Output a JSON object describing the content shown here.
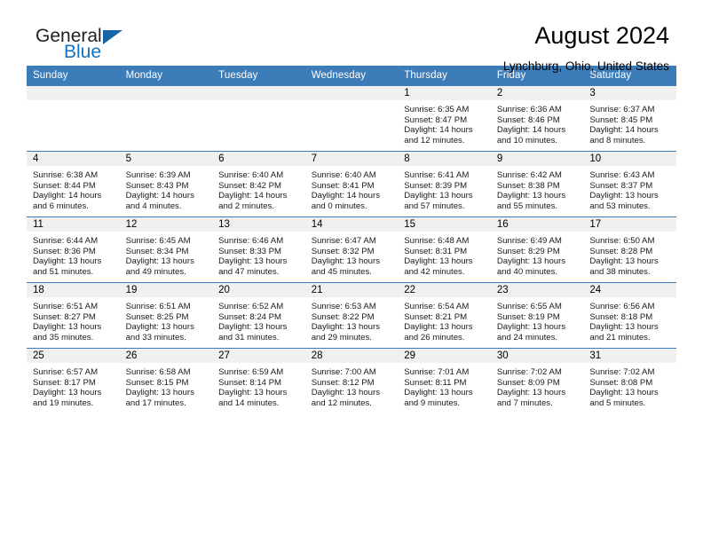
{
  "brand": {
    "word1": "General",
    "word2": "Blue",
    "triangle_color": "#1565a8",
    "word2_color": "#1272c4"
  },
  "header": {
    "title": "August 2024",
    "subtitle": "Lynchburg, Ohio, United States"
  },
  "theme": {
    "header_blue": "#3c7cb8",
    "daynum_band": "#f0f0f0",
    "row_divider": "#3c7cb8"
  },
  "weekday_headers": [
    "Sunday",
    "Monday",
    "Tuesday",
    "Wednesday",
    "Thursday",
    "Friday",
    "Saturday"
  ],
  "labels": {
    "sunrise_prefix": "Sunrise:",
    "sunset_prefix": "Sunset:",
    "daylight_prefix": "Daylight:"
  },
  "weeks": [
    [
      {
        "day": "",
        "sunrise": "",
        "sunset": "",
        "daylight_line1": "",
        "daylight_line2": ""
      },
      {
        "day": "",
        "sunrise": "",
        "sunset": "",
        "daylight_line1": "",
        "daylight_line2": ""
      },
      {
        "day": "",
        "sunrise": "",
        "sunset": "",
        "daylight_line1": "",
        "daylight_line2": ""
      },
      {
        "day": "",
        "sunrise": "",
        "sunset": "",
        "daylight_line1": "",
        "daylight_line2": ""
      },
      {
        "day": "1",
        "sunrise": "Sunrise: 6:35 AM",
        "sunset": "Sunset: 8:47 PM",
        "daylight_line1": "Daylight: 14 hours",
        "daylight_line2": "and 12 minutes."
      },
      {
        "day": "2",
        "sunrise": "Sunrise: 6:36 AM",
        "sunset": "Sunset: 8:46 PM",
        "daylight_line1": "Daylight: 14 hours",
        "daylight_line2": "and 10 minutes."
      },
      {
        "day": "3",
        "sunrise": "Sunrise: 6:37 AM",
        "sunset": "Sunset: 8:45 PM",
        "daylight_line1": "Daylight: 14 hours",
        "daylight_line2": "and 8 minutes."
      }
    ],
    [
      {
        "day": "4",
        "sunrise": "Sunrise: 6:38 AM",
        "sunset": "Sunset: 8:44 PM",
        "daylight_line1": "Daylight: 14 hours",
        "daylight_line2": "and 6 minutes."
      },
      {
        "day": "5",
        "sunrise": "Sunrise: 6:39 AM",
        "sunset": "Sunset: 8:43 PM",
        "daylight_line1": "Daylight: 14 hours",
        "daylight_line2": "and 4 minutes."
      },
      {
        "day": "6",
        "sunrise": "Sunrise: 6:40 AM",
        "sunset": "Sunset: 8:42 PM",
        "daylight_line1": "Daylight: 14 hours",
        "daylight_line2": "and 2 minutes."
      },
      {
        "day": "7",
        "sunrise": "Sunrise: 6:40 AM",
        "sunset": "Sunset: 8:41 PM",
        "daylight_line1": "Daylight: 14 hours",
        "daylight_line2": "and 0 minutes."
      },
      {
        "day": "8",
        "sunrise": "Sunrise: 6:41 AM",
        "sunset": "Sunset: 8:39 PM",
        "daylight_line1": "Daylight: 13 hours",
        "daylight_line2": "and 57 minutes."
      },
      {
        "day": "9",
        "sunrise": "Sunrise: 6:42 AM",
        "sunset": "Sunset: 8:38 PM",
        "daylight_line1": "Daylight: 13 hours",
        "daylight_line2": "and 55 minutes."
      },
      {
        "day": "10",
        "sunrise": "Sunrise: 6:43 AM",
        "sunset": "Sunset: 8:37 PM",
        "daylight_line1": "Daylight: 13 hours",
        "daylight_line2": "and 53 minutes."
      }
    ],
    [
      {
        "day": "11",
        "sunrise": "Sunrise: 6:44 AM",
        "sunset": "Sunset: 8:36 PM",
        "daylight_line1": "Daylight: 13 hours",
        "daylight_line2": "and 51 minutes."
      },
      {
        "day": "12",
        "sunrise": "Sunrise: 6:45 AM",
        "sunset": "Sunset: 8:34 PM",
        "daylight_line1": "Daylight: 13 hours",
        "daylight_line2": "and 49 minutes."
      },
      {
        "day": "13",
        "sunrise": "Sunrise: 6:46 AM",
        "sunset": "Sunset: 8:33 PM",
        "daylight_line1": "Daylight: 13 hours",
        "daylight_line2": "and 47 minutes."
      },
      {
        "day": "14",
        "sunrise": "Sunrise: 6:47 AM",
        "sunset": "Sunset: 8:32 PM",
        "daylight_line1": "Daylight: 13 hours",
        "daylight_line2": "and 45 minutes."
      },
      {
        "day": "15",
        "sunrise": "Sunrise: 6:48 AM",
        "sunset": "Sunset: 8:31 PM",
        "daylight_line1": "Daylight: 13 hours",
        "daylight_line2": "and 42 minutes."
      },
      {
        "day": "16",
        "sunrise": "Sunrise: 6:49 AM",
        "sunset": "Sunset: 8:29 PM",
        "daylight_line1": "Daylight: 13 hours",
        "daylight_line2": "and 40 minutes."
      },
      {
        "day": "17",
        "sunrise": "Sunrise: 6:50 AM",
        "sunset": "Sunset: 8:28 PM",
        "daylight_line1": "Daylight: 13 hours",
        "daylight_line2": "and 38 minutes."
      }
    ],
    [
      {
        "day": "18",
        "sunrise": "Sunrise: 6:51 AM",
        "sunset": "Sunset: 8:27 PM",
        "daylight_line1": "Daylight: 13 hours",
        "daylight_line2": "and 35 minutes."
      },
      {
        "day": "19",
        "sunrise": "Sunrise: 6:51 AM",
        "sunset": "Sunset: 8:25 PM",
        "daylight_line1": "Daylight: 13 hours",
        "daylight_line2": "and 33 minutes."
      },
      {
        "day": "20",
        "sunrise": "Sunrise: 6:52 AM",
        "sunset": "Sunset: 8:24 PM",
        "daylight_line1": "Daylight: 13 hours",
        "daylight_line2": "and 31 minutes."
      },
      {
        "day": "21",
        "sunrise": "Sunrise: 6:53 AM",
        "sunset": "Sunset: 8:22 PM",
        "daylight_line1": "Daylight: 13 hours",
        "daylight_line2": "and 29 minutes."
      },
      {
        "day": "22",
        "sunrise": "Sunrise: 6:54 AM",
        "sunset": "Sunset: 8:21 PM",
        "daylight_line1": "Daylight: 13 hours",
        "daylight_line2": "and 26 minutes."
      },
      {
        "day": "23",
        "sunrise": "Sunrise: 6:55 AM",
        "sunset": "Sunset: 8:19 PM",
        "daylight_line1": "Daylight: 13 hours",
        "daylight_line2": "and 24 minutes."
      },
      {
        "day": "24",
        "sunrise": "Sunrise: 6:56 AM",
        "sunset": "Sunset: 8:18 PM",
        "daylight_line1": "Daylight: 13 hours",
        "daylight_line2": "and 21 minutes."
      }
    ],
    [
      {
        "day": "25",
        "sunrise": "Sunrise: 6:57 AM",
        "sunset": "Sunset: 8:17 PM",
        "daylight_line1": "Daylight: 13 hours",
        "daylight_line2": "and 19 minutes."
      },
      {
        "day": "26",
        "sunrise": "Sunrise: 6:58 AM",
        "sunset": "Sunset: 8:15 PM",
        "daylight_line1": "Daylight: 13 hours",
        "daylight_line2": "and 17 minutes."
      },
      {
        "day": "27",
        "sunrise": "Sunrise: 6:59 AM",
        "sunset": "Sunset: 8:14 PM",
        "daylight_line1": "Daylight: 13 hours",
        "daylight_line2": "and 14 minutes."
      },
      {
        "day": "28",
        "sunrise": "Sunrise: 7:00 AM",
        "sunset": "Sunset: 8:12 PM",
        "daylight_line1": "Daylight: 13 hours",
        "daylight_line2": "and 12 minutes."
      },
      {
        "day": "29",
        "sunrise": "Sunrise: 7:01 AM",
        "sunset": "Sunset: 8:11 PM",
        "daylight_line1": "Daylight: 13 hours",
        "daylight_line2": "and 9 minutes."
      },
      {
        "day": "30",
        "sunrise": "Sunrise: 7:02 AM",
        "sunset": "Sunset: 8:09 PM",
        "daylight_line1": "Daylight: 13 hours",
        "daylight_line2": "and 7 minutes."
      },
      {
        "day": "31",
        "sunrise": "Sunrise: 7:02 AM",
        "sunset": "Sunset: 8:08 PM",
        "daylight_line1": "Daylight: 13 hours",
        "daylight_line2": "and 5 minutes."
      }
    ]
  ]
}
